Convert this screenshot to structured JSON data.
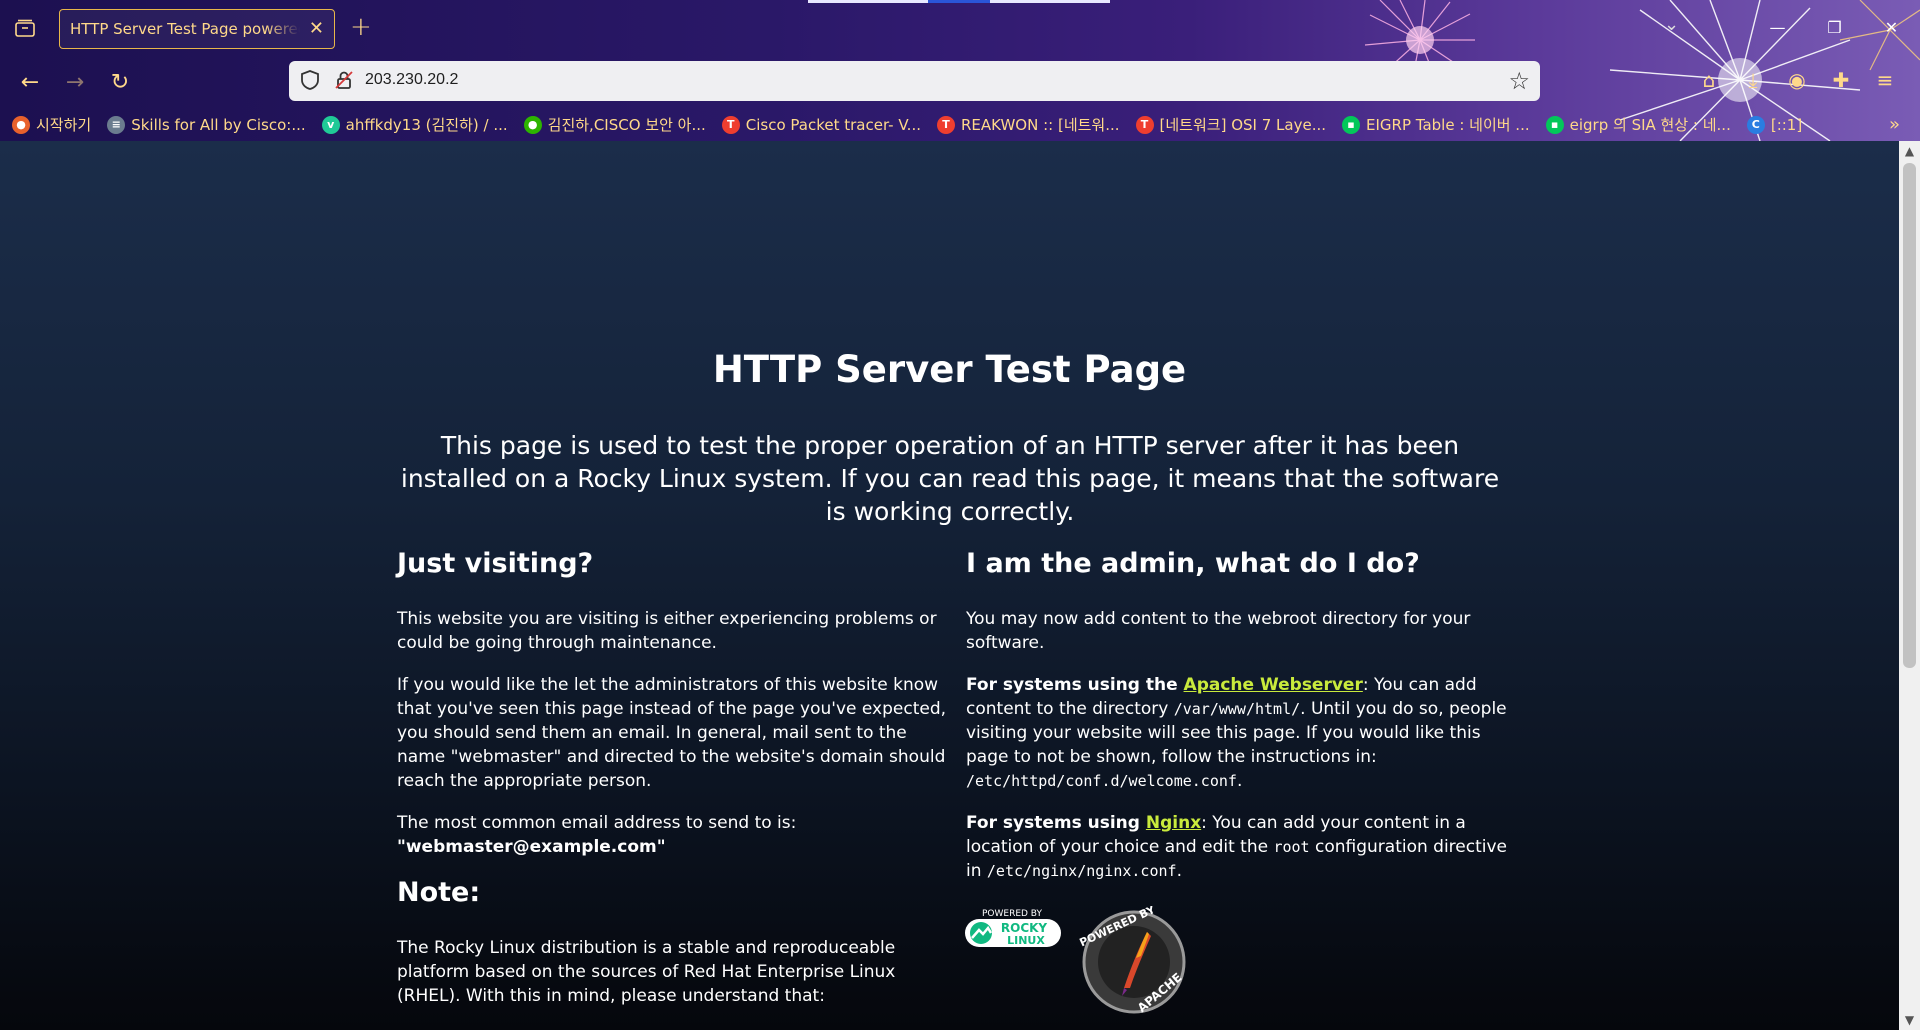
{
  "browser": {
    "tab_title": "HTTP Server Test Page powered by Rocky Linux",
    "url": "203.230.20.2",
    "bookmarks": [
      {
        "label": "시작하기",
        "color": "#e8612c",
        "glyph": "●"
      },
      {
        "label": "Skills for All by Cisco:...",
        "color": "#6b7c8f",
        "glyph": "≡"
      },
      {
        "label": "ahffkdy13 (김진하) / ...",
        "color": "#20c997",
        "glyph": "v"
      },
      {
        "label": "김진하,CISCO 보안 아...",
        "color": "#2db400",
        "glyph": "●"
      },
      {
        "label": "Cisco Packet tracer- V...",
        "color": "#ef3e2f",
        "glyph": "T"
      },
      {
        "label": "REAKWON :: [네트워...",
        "color": "#ef3e2f",
        "glyph": "T"
      },
      {
        "label": "[네트워크] OSI 7 Laye...",
        "color": "#ef3e2f",
        "glyph": "T"
      },
      {
        "label": "EIGRP Table : 네이버 ...",
        "color": "#03c75a",
        "glyph": "▪"
      },
      {
        "label": "eigrp 의 SIA 현상 : 네...",
        "color": "#03c75a",
        "glyph": "▪"
      },
      {
        "label": "[::1]",
        "color": "#2a7de1",
        "glyph": "C"
      }
    ]
  },
  "page": {
    "title": "HTTP Server Test Page",
    "lead": "This page is used to test the proper operation of an HTTP server after it has been installed on a Rocky Linux system. If you can read this page, it means that the software is working correctly.",
    "left": {
      "heading": "Just visiting?",
      "p1": "This website you are visiting is either experiencing problems or could be going through maintenance.",
      "p2": "If you would like the let the administrators of this website know that you've seen this page instead of the page you've expected, you should send them an email. In general, mail sent to the name \"webmaster\" and directed to the website's domain should reach the appropriate person.",
      "p3": "The most common email address to send to is:",
      "email": "\"webmaster@example.com\"",
      "note_heading": "Note:",
      "p4": "The Rocky Linux distribution is a stable and reproduceable platform based on the sources of Red Hat Enterprise Linux (RHEL). With this in mind, please understand that:"
    },
    "right": {
      "heading": "I am the admin, what do I do?",
      "p1": "You may now add content to the webroot directory for your software.",
      "apache_prefix": "For systems using the ",
      "apache_link": "Apache Webserver",
      "apache_text1": ": You can add content to the directory ",
      "apache_dir": "/var/www/html/",
      "apache_text2": ". Until you do so, people visiting your website will see this page. If you would like this page to not be shown, follow the instructions in: ",
      "apache_conf": "/etc/httpd/conf.d/welcome.conf",
      "apache_end": ".",
      "nginx_prefix": "For systems using ",
      "nginx_link": "Nginx",
      "nginx_text1": ": You can add your content in a location of your choice and edit the ",
      "nginx_root": "root",
      "nginx_text2": " configuration directive in ",
      "nginx_conf": "/etc/nginx/nginx.conf",
      "nginx_end": "."
    },
    "logos": {
      "rocky_small": "POWERED BY",
      "rocky_main": "ROCKY",
      "rocky_sub": "LINUX",
      "apache_top": "POWERED BY",
      "apache_bottom": "APACHE"
    }
  }
}
